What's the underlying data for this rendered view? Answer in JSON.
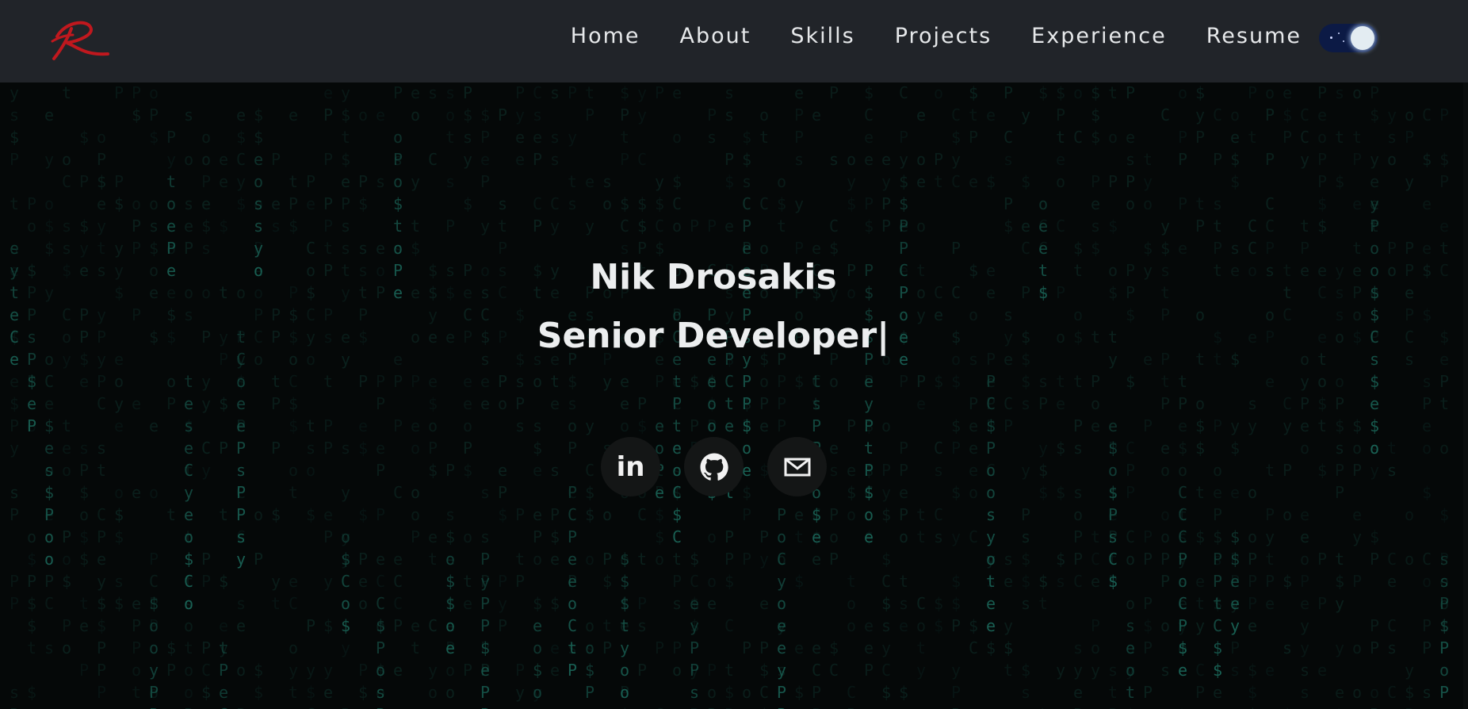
{
  "nav": {
    "logo_alt": "R",
    "links": [
      "Home",
      "About",
      "Skills",
      "Projects",
      "Experience",
      "Resume"
    ]
  },
  "hero": {
    "name": "Nik Drosakis",
    "title": "Senior Developer",
    "cursor": "|"
  },
  "social": {
    "linkedin_label": "in",
    "icons": [
      "linkedin-icon",
      "github-icon",
      "mail-icon"
    ]
  },
  "matrix": {
    "glyphs": "$yotPPs$oePCe"
  },
  "colors": {
    "navbar_bg": "#212429",
    "page_bg": "#050808",
    "matrix_glyph": "#1f7a6a",
    "logo_red": "#c0181e",
    "toggle_bg": "#0c1a45"
  }
}
